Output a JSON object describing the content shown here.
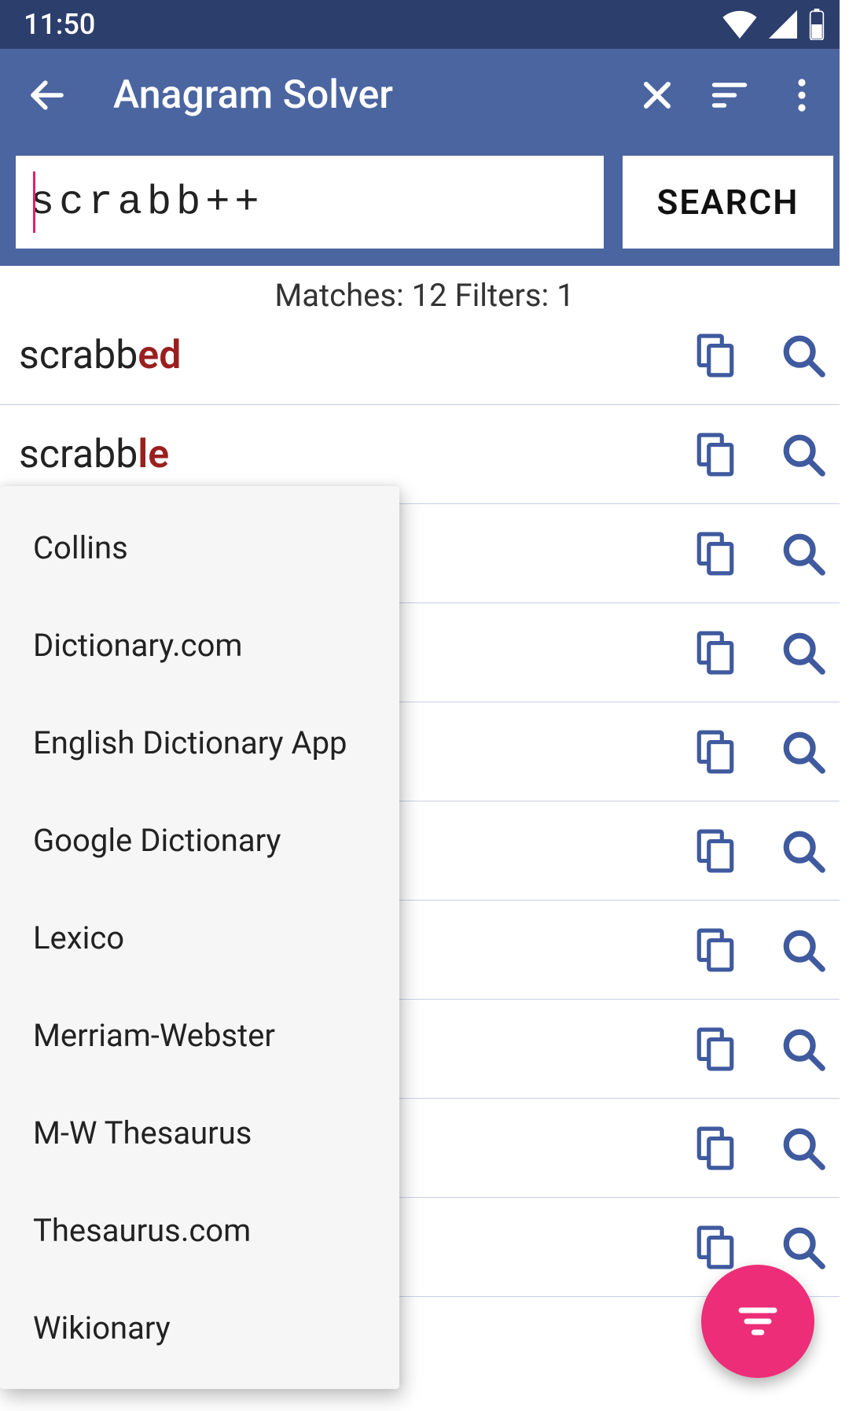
{
  "status": {
    "time": "11:50"
  },
  "appbar": {
    "title": "Anagram Solver"
  },
  "search": {
    "value": "scrabb++",
    "button": "SEARCH"
  },
  "info": {
    "prefix": "Matches: ",
    "matches": "12",
    "mid": " Filters: ",
    "filters": "1"
  },
  "results": [
    {
      "base": "scrabb",
      "suffix": "ed"
    },
    {
      "base": "scrabb",
      "suffix": "le"
    },
    {
      "base": "",
      "suffix": ""
    },
    {
      "base": "",
      "suffix": ""
    },
    {
      "base": "",
      "suffix": ""
    },
    {
      "base": "",
      "suffix": ""
    },
    {
      "base": "",
      "suffix": ""
    },
    {
      "base": "",
      "suffix": ""
    },
    {
      "base": "",
      "suffix": ""
    },
    {
      "base": "",
      "suffix": ""
    }
  ],
  "popup": {
    "items": [
      "Collins",
      "Dictionary.com",
      "English Dictionary App",
      "Google Dictionary",
      "Lexico",
      "Merriam-Webster",
      "M-W Thesaurus",
      "Thesaurus.com",
      "Wikionary"
    ]
  },
  "colors": {
    "accent": "#4b65a0",
    "fab": "#ed2d78",
    "suffix": "#9a1f1f",
    "iconBlue": "#3f5a9e"
  }
}
